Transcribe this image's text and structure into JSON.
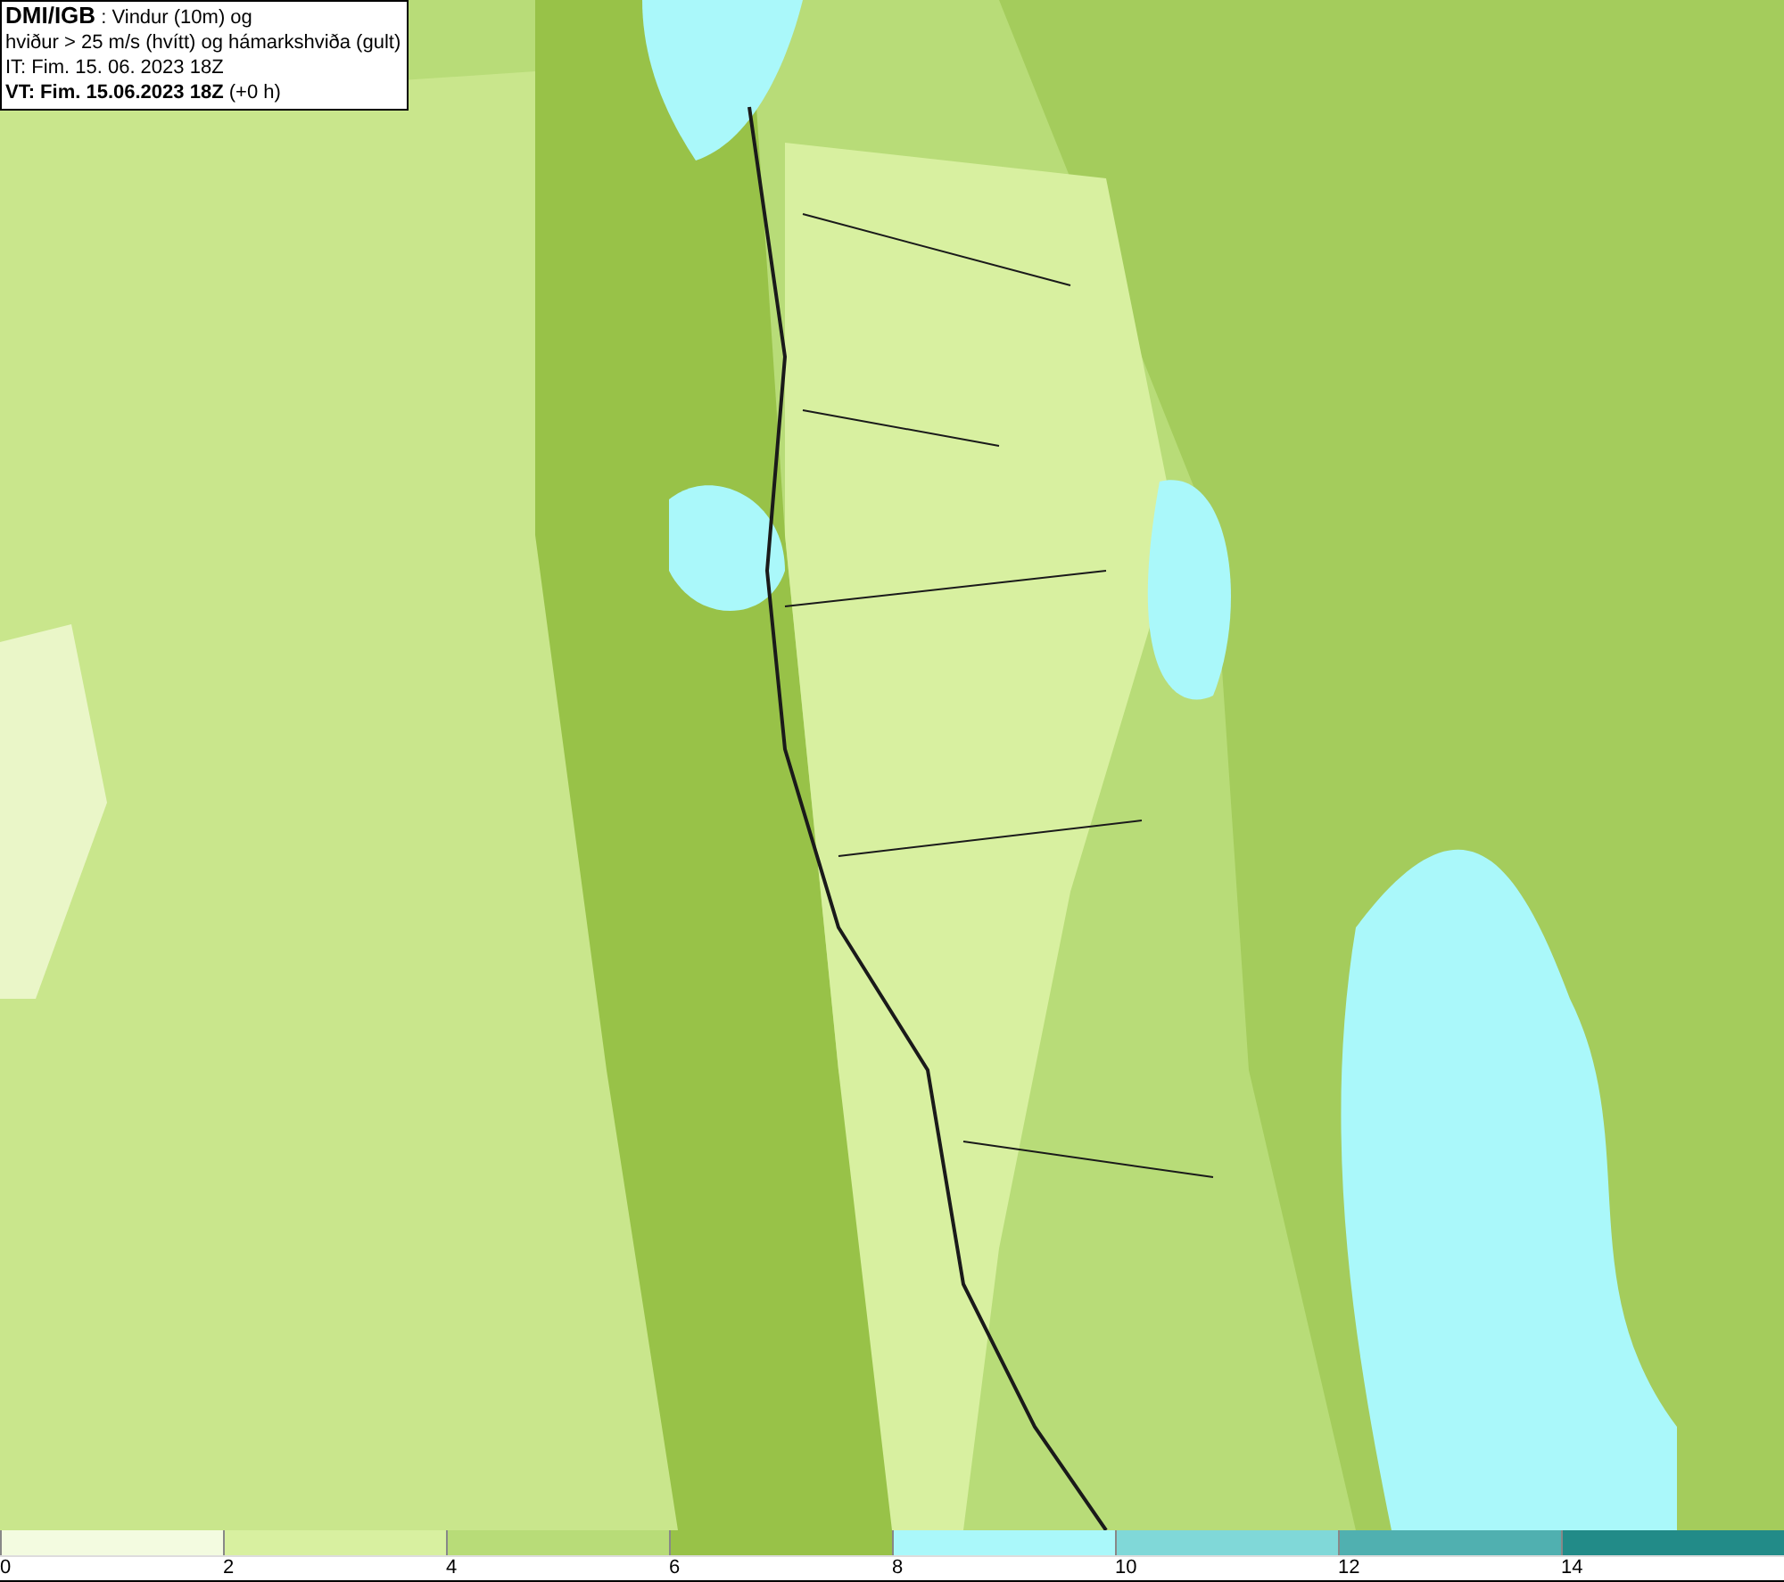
{
  "title_box": {
    "lines": [
      "**DMI/IGB** : Vindur (10m) og",
      "hviður > 25 m/s (hvítt) og hámarkshviða (gult)",
      "IT: Fim. 15. 06. 2023 18Z",
      "**VT: Fim. 15.06.2023 18Z** (+0 h)"
    ]
  },
  "legend": [
    {
      "label": "0",
      "color": "#f3fbe0"
    },
    {
      "label": "2",
      "color": "#d8f0a0"
    },
    {
      "label": "4",
      "color": "#b8dc78"
    },
    {
      "label": "6",
      "color": "#98c248"
    },
    {
      "label": "8",
      "color": "#aaf8fa"
    },
    {
      "label": "10",
      "color": "#80d8d8"
    },
    {
      "label": "12",
      "color": "#50b0b0"
    },
    {
      "label": "14",
      "color": "#228b88"
    }
  ]
}
